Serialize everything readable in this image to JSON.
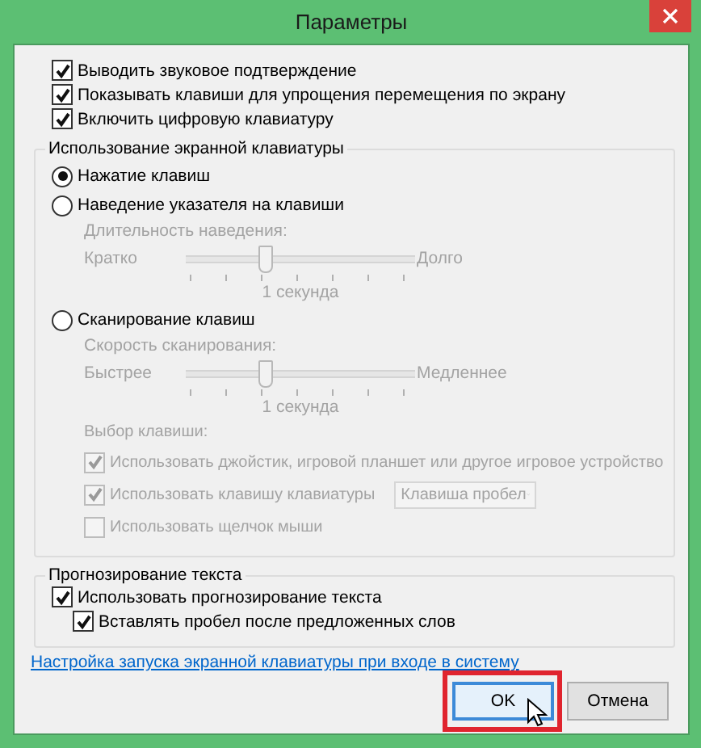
{
  "window": {
    "title": "Параметры"
  },
  "options": [
    {
      "label": "Выводить звуковое подтверждение",
      "checked": true
    },
    {
      "label": "Показывать клавиши для упрощения перемещения по экрану",
      "checked": true
    },
    {
      "label": "Включить цифровую клавиатуру",
      "checked": true
    }
  ],
  "keyboard_group": {
    "title": "Использование экранной клавиатуры",
    "modes": [
      {
        "label": "Нажатие клавиш",
        "selected": true
      },
      {
        "label": "Наведение указателя на клавиши",
        "selected": false,
        "slider": {
          "caption": "Длительность наведения:",
          "min_label": "Кратко",
          "max_label": "Долго",
          "level": 0.35,
          "reading": "1 секунда",
          "disabled": true
        }
      },
      {
        "label": "Сканирование клавиш",
        "selected": false,
        "slider": {
          "caption": "Скорость сканирования:",
          "min_label": "Быстрее",
          "max_label": "Медленнее",
          "level": 0.35,
          "reading": "1 секунда",
          "disabled": true
        },
        "key_choice": {
          "caption": "Выбор клавиши:",
          "options": [
            {
              "label": "Использовать джойстик, игровой планшет или другое игровое устройство",
              "checked": true,
              "disabled": true
            },
            {
              "label": "Использовать клавишу клавиатуры",
              "checked": true,
              "disabled": true,
              "dropdown": "Клавиша пробел"
            },
            {
              "label": "Использовать щелчок мыши",
              "checked": false,
              "disabled": true
            }
          ]
        }
      }
    ]
  },
  "prediction_group": {
    "title": "Прогнозирование текста",
    "options": [
      {
        "label": "Использовать прогнозирование текста",
        "checked": true,
        "children": [
          {
            "label": "Вставлять пробел после предложенных слов",
            "checked": true
          }
        ]
      }
    ]
  },
  "link": "Настройка запуска экранной клавиатуры при входе в систему",
  "buttons": [
    {
      "label": "OK",
      "default": true,
      "highlighted": true
    },
    {
      "label": "Отмена",
      "default": false,
      "highlighted": false
    }
  ]
}
